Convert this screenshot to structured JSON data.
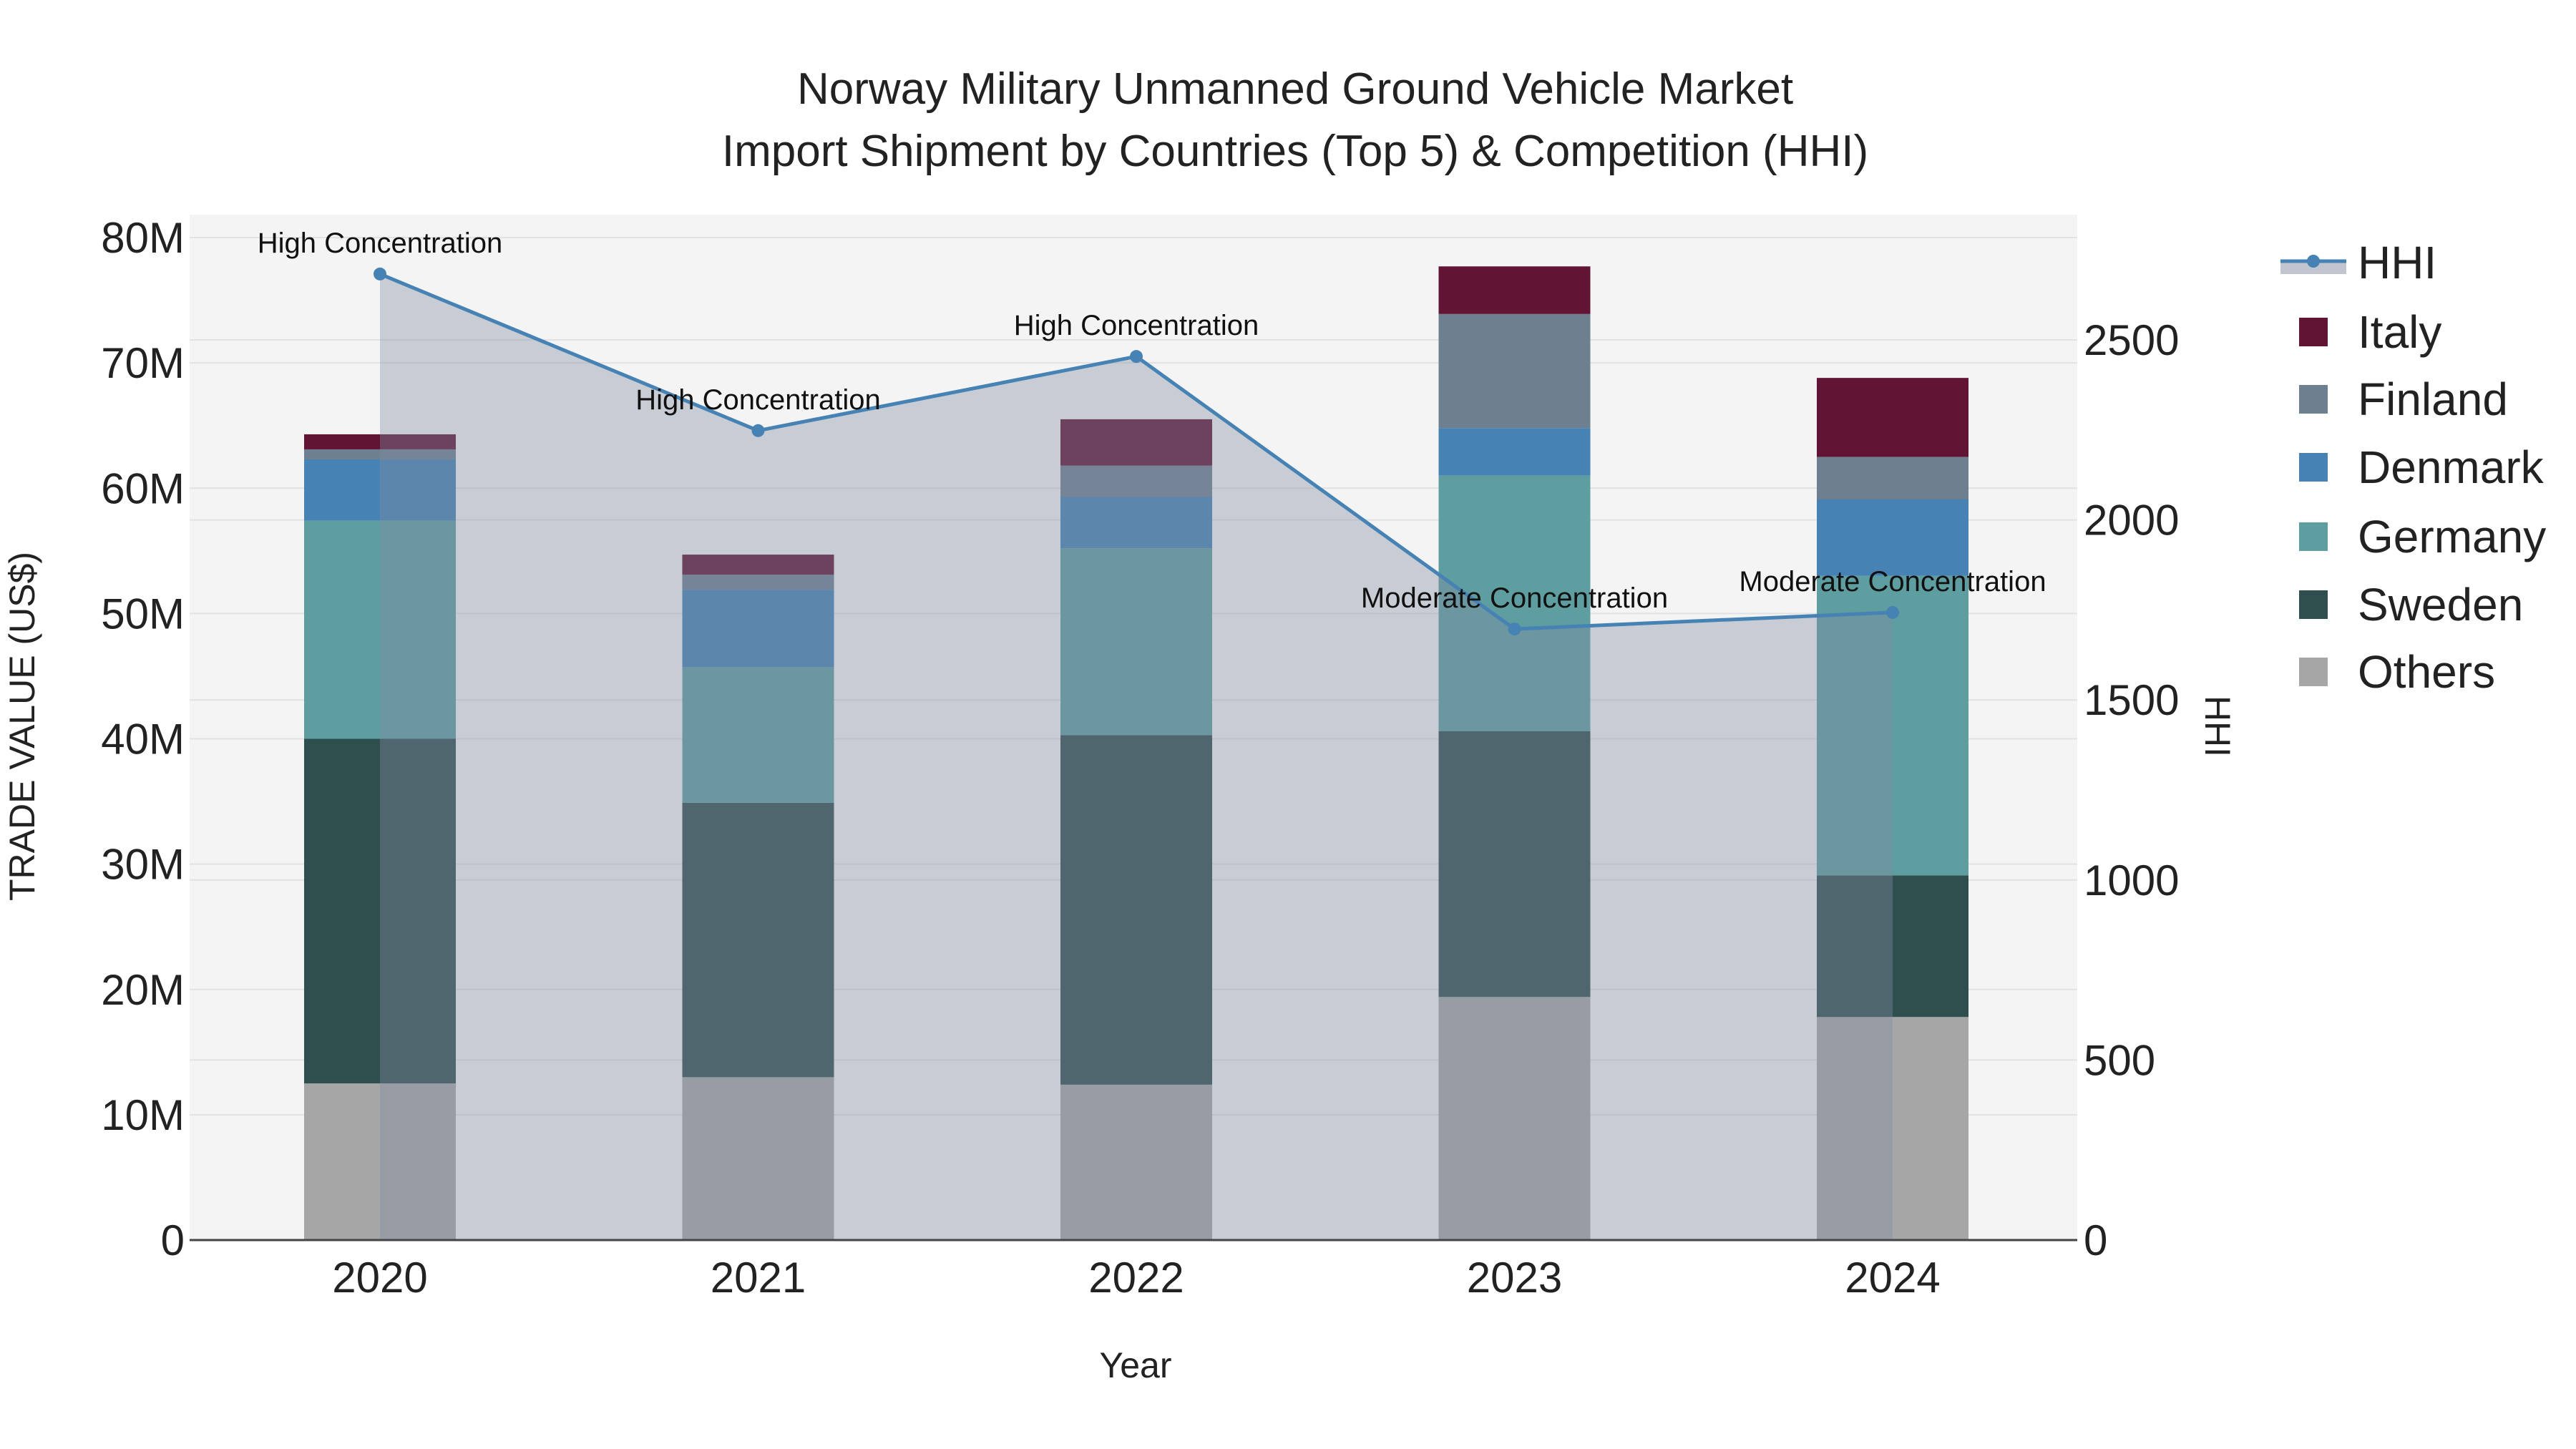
{
  "chart_data": {
    "type": "bar",
    "stacked": true,
    "title": [
      "Norway Military Unmanned Ground Vehicle Market",
      "Import Shipment by Countries (Top 5) & Competition (HHI)"
    ],
    "xlabel": "Year",
    "ylabel": "TRADE VALUE (US$)",
    "y2label": "HHI",
    "categories": [
      "2020",
      "2021",
      "2022",
      "2023",
      "2024"
    ],
    "ylim": [
      0,
      80000000
    ],
    "yticks": [
      0,
      10000000,
      20000000,
      30000000,
      40000000,
      50000000,
      60000000,
      70000000,
      80000000
    ],
    "ytick_labels": [
      "0",
      "10M",
      "20M",
      "30M",
      "40M",
      "50M",
      "60M",
      "70M",
      "80M"
    ],
    "y2ticks": [
      0,
      500,
      1000,
      1500,
      2000,
      2500
    ],
    "y2tick_labels": [
      "0",
      "500",
      "1000",
      "1500",
      "2000",
      "2500"
    ],
    "grid": true,
    "legend_position": "right",
    "series": [
      {
        "name": "Others",
        "color": "#a6a6a6",
        "values": [
          12.5,
          13.0,
          12.4,
          19.4,
          17.8
        ]
      },
      {
        "name": "Sweden",
        "color": "#2f4f4f",
        "values": [
          27.5,
          21.9,
          27.9,
          21.2,
          11.3
        ]
      },
      {
        "name": "Germany",
        "color": "#5f9ea0",
        "values": [
          17.4,
          10.8,
          14.9,
          20.4,
          23.9
        ]
      },
      {
        "name": "Denmark",
        "color": "#4682b4",
        "values": [
          4.9,
          6.2,
          4.1,
          3.8,
          6.1
        ]
      },
      {
        "name": "Finland",
        "color": "#6e7f8f",
        "values": [
          0.8,
          1.2,
          2.5,
          9.1,
          3.4
        ]
      },
      {
        "name": "Italy",
        "color": "#611434",
        "values": [
          1.2,
          1.6,
          3.7,
          3.8,
          6.3
        ]
      }
    ],
    "value_unit": "million US$",
    "hhi": {
      "name": "HHI",
      "color": "#4682b4",
      "values": [
        2683,
        2248,
        2454,
        1697,
        1743
      ],
      "annotations": [
        "High Concentration",
        "High Concentration",
        "High Concentration",
        "Moderate Concentration",
        "Moderate Concentration"
      ]
    },
    "legend_order": [
      "HHI",
      "Italy",
      "Finland",
      "Denmark",
      "Germany",
      "Sweden",
      "Others"
    ]
  }
}
